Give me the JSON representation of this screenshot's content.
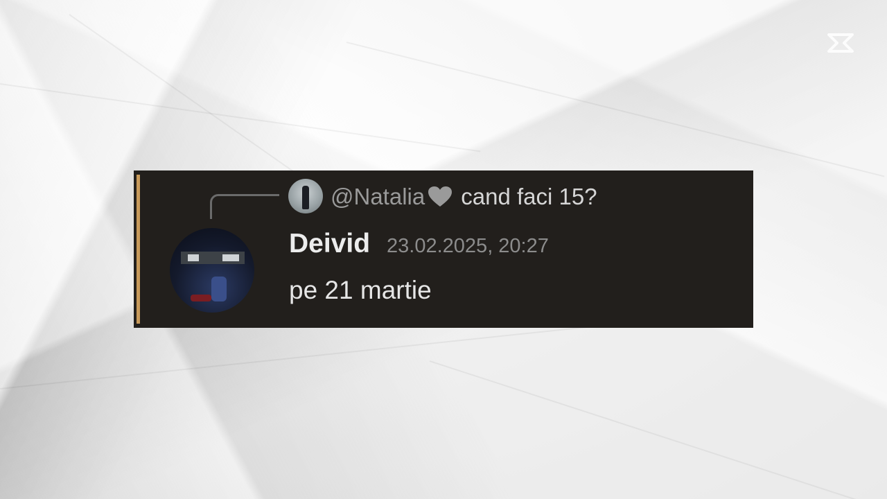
{
  "watermark": {
    "icon": "capcut-logo-icon"
  },
  "message": {
    "reply": {
      "author": "@Natalia",
      "author_suffix_icon": "heart-icon",
      "text": "cand faci 15?",
      "avatar_icon": "user-avatar"
    },
    "author": "Deivid",
    "timestamp": "23.02.2025, 20:27",
    "text": "pe 21 martie",
    "avatar_icon": "user-avatar"
  },
  "colors": {
    "card_background": "#221f1c",
    "accent_bar": "#c89a5a",
    "reply_author": "#9a9a9a",
    "timestamp": "#8c8c8c",
    "message_text": "#e6e6e6"
  }
}
